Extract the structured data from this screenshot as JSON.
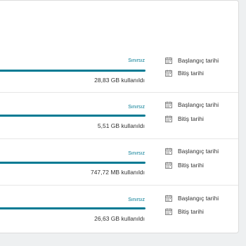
{
  "accent_color": "#017a93",
  "packages": [
    {
      "limit_label": "Sınırsız",
      "usage_label": "28,83 GB kullanıldı",
      "progress_fraction": 1.0,
      "start_label": "Başlangıç tarihi",
      "end_label": "Bitiş tarihi"
    },
    {
      "limit_label": "Sınırsız",
      "usage_label": "5,51 GB kullanıldı",
      "progress_fraction": 1.0,
      "start_label": "Başlangıç tarihi",
      "end_label": "Bitiş tarihi"
    },
    {
      "limit_label": "Sınırsız",
      "usage_label": "747,72 MB kullanıldı",
      "progress_fraction": 1.0,
      "start_label": "Başlangıç tarihi",
      "end_label": "Bitiş tarihi"
    },
    {
      "limit_label": "Sınırsız",
      "usage_label": "26,63 GB kullanıldı",
      "progress_fraction": 1.0,
      "start_label": "Başlangıç tarihi",
      "end_label": "Bitiş tarihi"
    }
  ]
}
